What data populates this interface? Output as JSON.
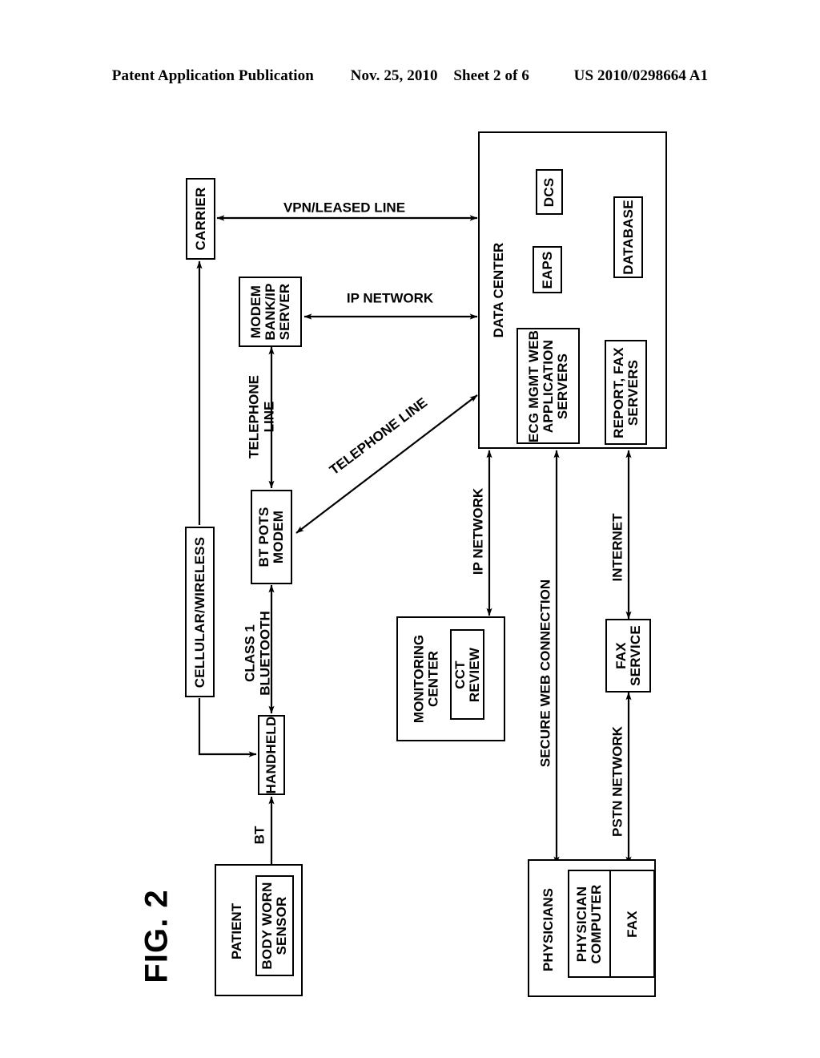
{
  "header": {
    "left": "Patent Application Publication",
    "date": "Nov. 25, 2010",
    "sheet": "Sheet 2 of 6",
    "patent_number": "US 2010/0298664 A1"
  },
  "figure": {
    "caption": "FIG. 2"
  },
  "nodes": {
    "carrier": "CARRIER",
    "modem_bank": "MODEM\nBANK/IP\nSERVER",
    "modem_bank_l1": "MODEM",
    "modem_bank_l2": "BANK/IP",
    "modem_bank_l3": "SERVER",
    "bt_pots_modem_l1": "BT POTS",
    "bt_pots_modem_l2": "MODEM",
    "cellular_wireless": "CELLULAR/WIRELESS",
    "handheld": "HANDHELD",
    "patient": "PATIENT",
    "body_worn_sensor_l1": "BODY WORN",
    "body_worn_sensor_l2": "SENSOR",
    "data_center": "DATA CENTER",
    "dcs": "DCS",
    "eaps": "EAPS",
    "database": "DATABASE",
    "ecg_servers_l1": "ECG MGMT WEB",
    "ecg_servers_l2": "APPLICATION",
    "ecg_servers_l3": "SERVERS",
    "report_fax_servers_l1": "REPORT, FAX",
    "report_fax_servers_l2": "SERVERS",
    "monitoring_center_l1": "MONITORING",
    "monitoring_center_l2": "CENTER",
    "cct_review_l1": "CCT",
    "cct_review_l2": "REVIEW",
    "fax_service_l1": "FAX",
    "fax_service_l2": "SERVICE",
    "physicians": "PHYSICIANS",
    "physician_computer_l1": "PHYSICIAN",
    "physician_computer_l2": "COMPUTER",
    "fax": "FAX"
  },
  "connections": {
    "vpn_leased_line": "VPN/LEASED LINE",
    "ip_network_horizontal": "IP NETWORK",
    "telephone_line_vertical_l1": "TELEPHONE",
    "telephone_line_vertical_l2": "LINE",
    "telephone_line_diagonal": "TELEPHONE LINE",
    "class1_bluetooth_l1": "CLASS 1",
    "class1_bluetooth_l2": "BLUETOOTH",
    "bt": "BT",
    "ip_network_vertical": "IP NETWORK",
    "secure_web_connection": "SECURE WEB CONNECTION",
    "internet": "INTERNET",
    "pstn_network": "PSTN NETWORK"
  },
  "colors": {
    "stroke": "#000000",
    "background": "#ffffff"
  }
}
